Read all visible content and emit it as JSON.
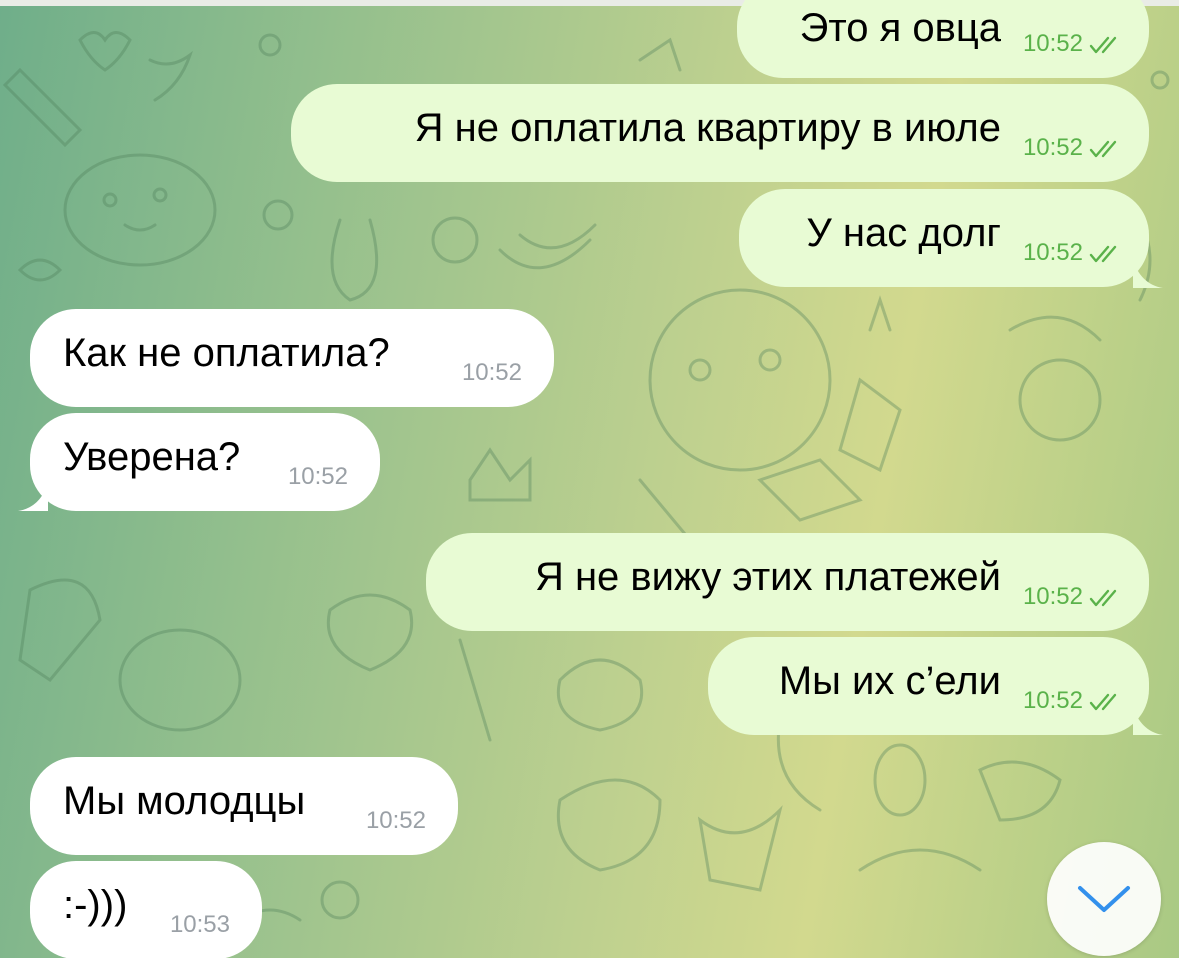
{
  "messages": [
    {
      "id": "m1",
      "direction": "out",
      "text": "Это я овца",
      "time": "10:52",
      "read": true
    },
    {
      "id": "m2",
      "direction": "out",
      "text": "Я не оплатила квартиру в июле",
      "time": "10:52",
      "read": true
    },
    {
      "id": "m3",
      "direction": "out",
      "text": "У нас долг",
      "time": "10:52",
      "read": true
    },
    {
      "id": "m4",
      "direction": "in",
      "text": "Как не оплатила?",
      "time": "10:52"
    },
    {
      "id": "m5",
      "direction": "in",
      "text": "Уверена?",
      "time": "10:52"
    },
    {
      "id": "m6",
      "direction": "out",
      "text": "Я не вижу этих платежей",
      "time": "10:52",
      "read": true
    },
    {
      "id": "m7",
      "direction": "out",
      "text": "Мы их с’ели",
      "time": "10:52",
      "read": true
    },
    {
      "id": "m8",
      "direction": "in",
      "text": "Мы молодцы",
      "time": "10:52"
    },
    {
      "id": "m9",
      "direction": "in",
      "text": ":-)))",
      "time": "10:53"
    }
  ],
  "scroll_button": {
    "icon": "chevron-down-icon"
  },
  "colors": {
    "outgoing_bubble": "#e8fbd4",
    "incoming_bubble": "#ffffff",
    "read_check": "#5ab24a",
    "accent": "#3390ec"
  }
}
